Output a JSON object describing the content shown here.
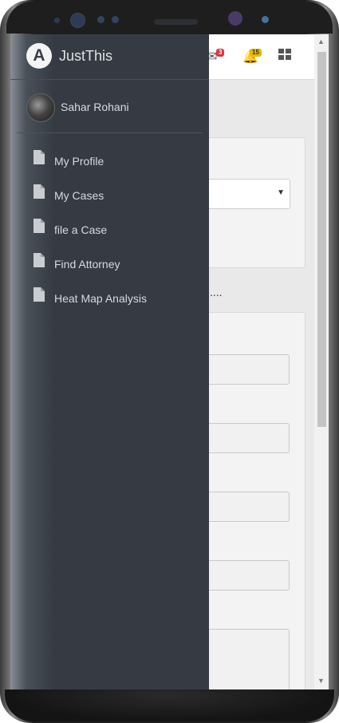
{
  "app": {
    "name": "JustThis",
    "logo_letter": "A"
  },
  "user": {
    "name": "Sahar Rohani"
  },
  "menu": {
    "items": [
      {
        "label": "My Profile",
        "icon": "file-icon"
      },
      {
        "label": "My Cases",
        "icon": "file-icon"
      },
      {
        "label": "file a Case",
        "icon": "file-icon"
      },
      {
        "label": "Find Attorney",
        "icon": "file-icon"
      },
      {
        "label": "Heat Map Analysis",
        "icon": "file-icon"
      }
    ]
  },
  "topbar": {
    "messages_badge": "3",
    "notifications_badge": "15",
    "badge_colors": {
      "messages": "#d9363e",
      "notifications": "#e6b800"
    }
  },
  "content": {
    "ellipsis": "...."
  },
  "colors": {
    "drawer": "#363b43",
    "drawer_text": "#d6d9dd"
  }
}
